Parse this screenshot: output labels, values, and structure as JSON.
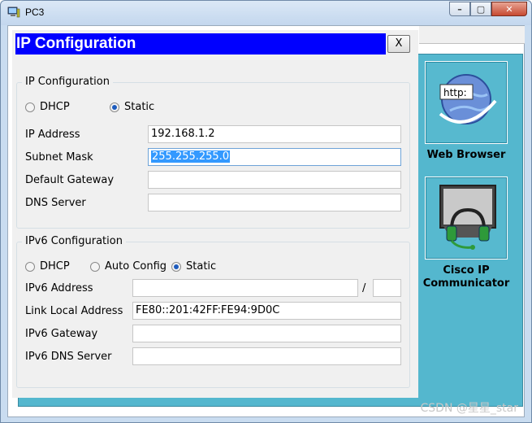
{
  "window": {
    "title": "PC3",
    "controls": [
      "–",
      "▢",
      "✕"
    ]
  },
  "dialog": {
    "title": "IP Configuration",
    "close_label": "X"
  },
  "ipv4": {
    "group_label": "IP Configuration",
    "dhcp_label": "DHCP",
    "static_label": "Static",
    "mode": "Static",
    "ip_label": "IP Address",
    "ip_value": "192.168.1.2",
    "mask_label": "Subnet Mask",
    "mask_value": "255.255.255.0",
    "gateway_label": "Default Gateway",
    "gateway_value": "",
    "dns_label": "DNS Server",
    "dns_value": ""
  },
  "ipv6": {
    "group_label": "IPv6 Configuration",
    "dhcp_label": "DHCP",
    "auto_label": "Auto Config",
    "static_label": "Static",
    "mode": "Static",
    "addr_label": "IPv6 Address",
    "addr_value": "",
    "slash": "/",
    "prefix_value": "",
    "linklocal_label": "Link Local Address",
    "linklocal_value": "FE80::201:42FF:FE94:9D0C",
    "gateway_label": "IPv6 Gateway",
    "gateway_value": "",
    "dns_label": "IPv6 DNS Server",
    "dns_value": ""
  },
  "apps": {
    "web_browser": "Web Browser",
    "web_icon_text": "http:",
    "cisco_ip_line1": "Cisco IP",
    "cisco_ip_line2": "Communicator"
  },
  "watermark": "CSDN @星星_star",
  "icons": [
    "pc-icon",
    "globe-http-icon",
    "phone-monitor-icon",
    "radio-icon"
  ]
}
